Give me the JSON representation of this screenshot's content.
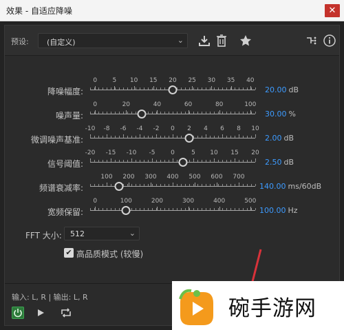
{
  "window": {
    "title": "效果 - 自适应降噪",
    "close_glyph": "✕"
  },
  "preset": {
    "label": "预设:",
    "value": "(自定义)"
  },
  "toolbar_icons": [
    "download-icon",
    "trash-icon",
    "star-icon",
    "routing-icon",
    "info-icon"
  ],
  "sliders": [
    {
      "label": "降噪幅度:",
      "ticks": [
        "0",
        "5",
        "10",
        "15",
        "20",
        "25",
        "30",
        "35",
        "40"
      ],
      "min": 0,
      "max": 40,
      "value": 20,
      "value_text": "20.00",
      "unit": "dB"
    },
    {
      "label": "噪声量:",
      "ticks": [
        "0",
        "20",
        "40",
        "60",
        "80",
        "100"
      ],
      "min": 0,
      "max": 100,
      "value": 30,
      "value_text": "30.00",
      "unit": "%"
    },
    {
      "label": "微调噪声基准:",
      "ticks": [
        "-10",
        "-8",
        "-6",
        "-4",
        "-2",
        "0",
        "2",
        "4",
        "6",
        "8",
        "10"
      ],
      "min": -10,
      "max": 10,
      "value": 2,
      "value_text": "2.00",
      "unit": "dB"
    },
    {
      "label": "信号阈值:",
      "ticks": [
        "-20",
        "-15",
        "-10",
        "-5",
        "0",
        "5",
        "10",
        "15",
        "20"
      ],
      "min": -20,
      "max": 20,
      "value": 2.5,
      "value_text": "2.50",
      "unit": "dB"
    },
    {
      "label": "频谱衰减率:",
      "ticks": [
        "100",
        "200",
        "300",
        "400",
        "500",
        "600",
        "700"
      ],
      "min": 0,
      "max": 800,
      "value": 140,
      "value_text": "140.00",
      "unit": "ms/60dB"
    },
    {
      "label": "宽频保留:",
      "ticks": [
        "0",
        "100",
        "200",
        "300",
        "400",
        "500"
      ],
      "min": 0,
      "max": 500,
      "value": 100,
      "value_text": "100.00",
      "unit": "Hz"
    }
  ],
  "fft": {
    "label": "FFT 大小:",
    "value": "512"
  },
  "high_quality": {
    "label": "高品质模式 (较慢)",
    "checked": true,
    "check_glyph": "✔"
  },
  "io": {
    "text": "输入: L, R | 输出: L, R"
  },
  "watermark": {
    "text": "碗手游网"
  },
  "colors": {
    "accent": "#3d9bff",
    "close": "#c4322b",
    "power": "#2d7a3a",
    "arrow": "#d8323a"
  }
}
